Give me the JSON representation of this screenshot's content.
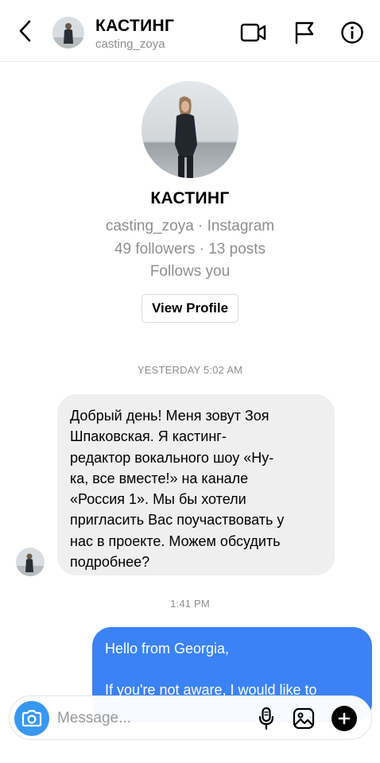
{
  "header": {
    "name": "КАСТИНГ",
    "username": "casting_zoya"
  },
  "profile": {
    "name": "КАСТИНГ",
    "line1": "casting_zoya · Instagram",
    "line2": "49 followers · 13 posts",
    "line3": "Follows you",
    "view_profile_label": "View Profile"
  },
  "thread": {
    "timestamp1": "YESTERDAY 5:02 AM",
    "incoming_lines": [
      "Добрый день! Меня зовут Зоя",
      "Шпаковская. Я кастинг-",
      "редактор вокального шоу «Ну-",
      "ка, все вместе!» на канале",
      "«Россия 1». Мы бы хотели",
      "пригласить Вас поучаствовать у",
      "нас в проекте. Можем обсудить",
      "подробнее?"
    ],
    "timestamp2": "1:41 PM",
    "outgoing_line1": "Hello from Georgia,",
    "outgoing_line2": "If you're not aware, I would like to"
  },
  "composer": {
    "placeholder": "Message..."
  },
  "icons": {
    "back": "chevron-left-icon",
    "video": "video-call-icon",
    "flag": "flag-icon",
    "info": "info-icon",
    "camera": "camera-icon",
    "mic": "microphone-icon",
    "gallery": "gallery-icon",
    "plus": "plus-icon"
  },
  "colors": {
    "accent_blue": "#3897f0",
    "outgoing_bubble": "#3b82f6",
    "incoming_bubble": "#efefef",
    "secondary_text": "#8e8e8e"
  }
}
